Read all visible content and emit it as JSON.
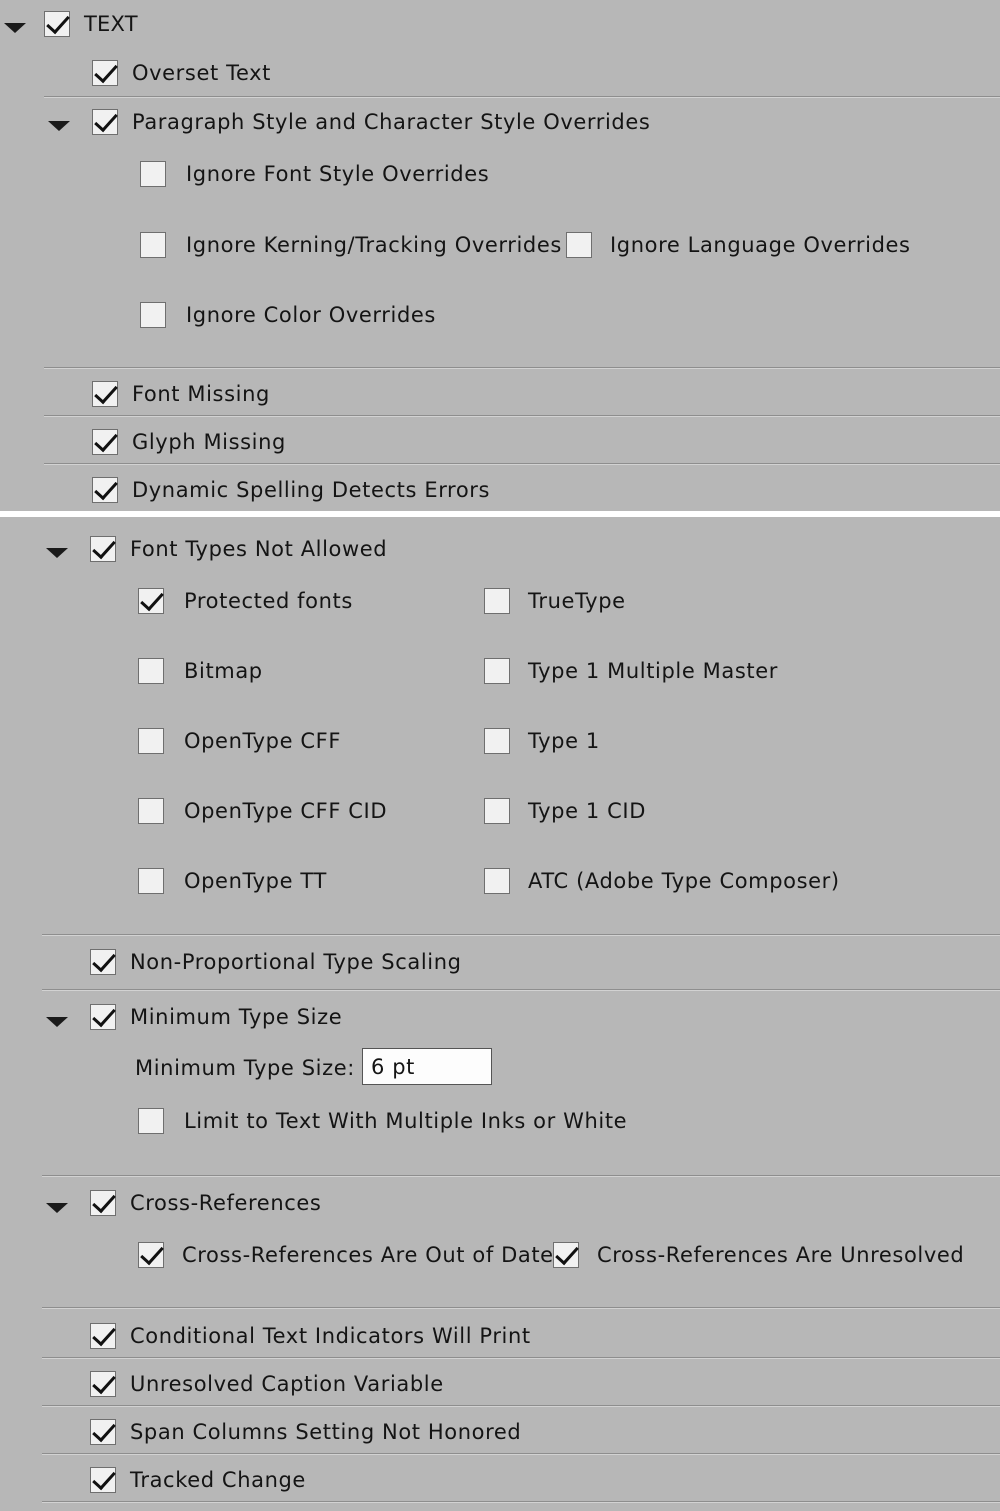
{
  "text_section": {
    "title": "TEXT",
    "overset_text": "Overset Text",
    "para_char_overrides": "Paragraph Style and Character Style Overrides",
    "ignore_font_style": "Ignore Font Style Overrides",
    "ignore_kerning": "Ignore Kerning/Tracking Overrides",
    "ignore_language": "Ignore Language Overrides",
    "ignore_color": "Ignore Color Overrides",
    "font_missing": "Font Missing",
    "glyph_missing": "Glyph Missing",
    "dynamic_spelling": "Dynamic Spelling Detects Errors"
  },
  "font_types": {
    "title": "Font Types Not Allowed",
    "protected": "Protected fonts",
    "truetype": "TrueType",
    "bitmap": "Bitmap",
    "type1_mm": "Type 1 Multiple Master",
    "opentype_cff": "OpenType CFF",
    "type1": "Type 1",
    "opentype_cff_cid": "OpenType CFF CID",
    "type1_cid": "Type 1 CID",
    "opentype_tt": "OpenType TT",
    "atc": "ATC (Adobe Type Composer)"
  },
  "non_proportional": "Non-Proportional Type Scaling",
  "min_type": {
    "title": "Minimum Type Size",
    "field_label": "Minimum Type Size:",
    "field_value": "6 pt",
    "limit_inks": "Limit to Text With Multiple Inks or White"
  },
  "xrefs": {
    "title": "Cross-References",
    "out_of_date": "Cross-References Are Out of Date",
    "unresolved": "Cross-References Are Unresolved"
  },
  "conditional_text": "Conditional Text Indicators Will Print",
  "caption_variable": "Unresolved Caption Variable",
  "span_columns": "Span Columns Setting Not Honored",
  "tracked_change": "Tracked Change"
}
